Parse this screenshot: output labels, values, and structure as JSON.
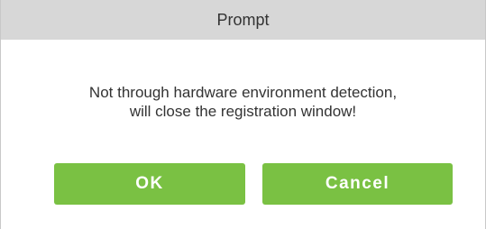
{
  "dialog": {
    "title": "Prompt",
    "message_lines": [
      "Not through hardware environment detection,",
      "will close the registration window!"
    ]
  },
  "buttons": {
    "ok_label": "OK",
    "cancel_label": "Cancel"
  },
  "colors": {
    "titlebar_bg": "#d7d7d7",
    "button_green": "#7ac143",
    "text": "#333333"
  }
}
